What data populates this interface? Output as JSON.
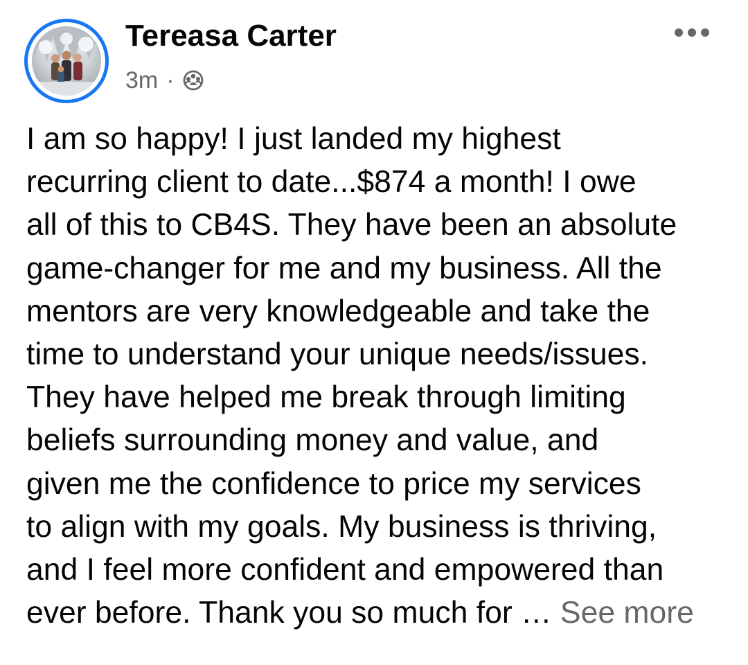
{
  "post": {
    "author": "Tereasa Carter",
    "timestamp": "3m",
    "separator": "·",
    "audience_icon": "group-icon",
    "more_icon": "more-options-icon",
    "text_lines": [
      "I am so happy! I just landed my highest",
      "recurring client to date...$874 a month! I owe",
      "all of this to CB4S. They have been an absolute",
      "game-changer for me and my business. All the",
      "mentors are very knowledgeable and take the",
      "time to understand your unique needs/issues.",
      "They have helped me break through limiting",
      "beliefs surrounding money and value, and",
      "given me the confidence to price my services",
      "to align with my goals. My business is thriving,",
      "and I feel more confident and empowered than"
    ],
    "last_line": "ever before. Thank you so much for … ",
    "see_more_label": "See more"
  },
  "colors": {
    "primary_text": "#050505",
    "secondary_text": "#65676b",
    "story_ring": "#1877f2"
  }
}
